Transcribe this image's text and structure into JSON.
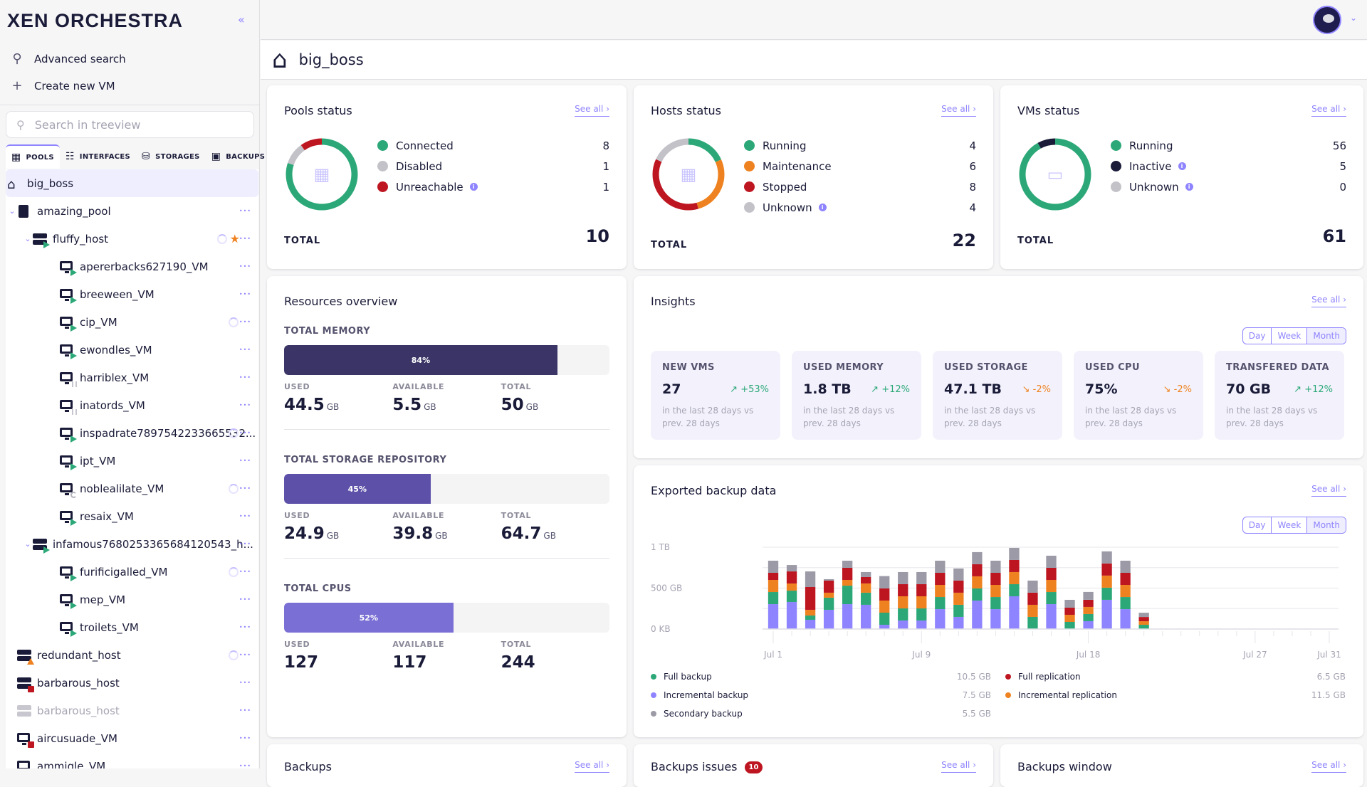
{
  "app": {
    "logo": "XEN ORCHESTRA",
    "collapse_icon": "«"
  },
  "sidebar": {
    "quick_actions": [
      {
        "label": "Advanced search",
        "icon": "search-icon"
      },
      {
        "label": "Create new VM",
        "icon": "plus-icon"
      }
    ],
    "search_placeholder": "Search in treeview",
    "tabs": [
      {
        "label": "POOLS",
        "icon": "building-icon",
        "active": true
      },
      {
        "label": "INTERFACES",
        "icon": "network-icon"
      },
      {
        "label": "STORAGES",
        "icon": "database-icon"
      },
      {
        "label": "BACKUPS",
        "icon": "save-icon"
      }
    ],
    "tree": [
      {
        "label": "big_boss",
        "type": "site",
        "depth": 0,
        "selected": true
      },
      {
        "label": "amazing_pool",
        "type": "pool",
        "depth": 0,
        "expanded": true
      },
      {
        "label": "fluffy_host",
        "type": "host",
        "depth": 1,
        "expanded": true,
        "status": "running",
        "loading": true,
        "master": true
      },
      {
        "label": "apererbacks627190_VM",
        "type": "vm",
        "depth": 2,
        "status": "running"
      },
      {
        "label": "breeween_VM",
        "type": "vm",
        "depth": 2,
        "status": "running"
      },
      {
        "label": "cip_VM",
        "type": "vm",
        "depth": 2,
        "status": "running",
        "loading": true
      },
      {
        "label": "ewondles_VM",
        "type": "vm",
        "depth": 2,
        "status": "running"
      },
      {
        "label": "harriblex_VM",
        "type": "vm",
        "depth": 2,
        "status": "paused"
      },
      {
        "label": "inatords_VM",
        "type": "vm",
        "depth": 2,
        "status": "paused"
      },
      {
        "label": "inspadrate7897542233665532...",
        "type": "vm",
        "depth": 2,
        "status": "running",
        "loading": true
      },
      {
        "label": "ipt_VM",
        "type": "vm",
        "depth": 2,
        "status": "running"
      },
      {
        "label": "noblealilate_VM",
        "type": "vm",
        "depth": 2,
        "status": "suspended",
        "loading": true
      },
      {
        "label": "resaix_VM",
        "type": "vm",
        "depth": 2,
        "status": "running"
      },
      {
        "label": "infamous7680253365684120543_h...",
        "type": "host",
        "depth": 1,
        "expanded": true,
        "status": "running"
      },
      {
        "label": "furificigalled_VM",
        "type": "vm",
        "depth": 2,
        "status": "running",
        "loading": true
      },
      {
        "label": "mep_VM",
        "type": "vm",
        "depth": 2,
        "status": "running"
      },
      {
        "label": "troilets_VM",
        "type": "vm",
        "depth": 2,
        "status": "running"
      },
      {
        "label": "redundant_host",
        "type": "host",
        "depth": 0,
        "status": "warning",
        "loading": true
      },
      {
        "label": "barbarous_host",
        "type": "host",
        "depth": 0,
        "status": "stopped"
      },
      {
        "label": "barbarous_host",
        "type": "host",
        "depth": 0,
        "status": "disabled"
      },
      {
        "label": "aircusuade_VM",
        "type": "vm",
        "depth": 0,
        "status": "stopped"
      },
      {
        "label": "ammiqle_VM",
        "type": "vm",
        "depth": 0,
        "status": "stopped"
      }
    ]
  },
  "header": {
    "avatar": "user-avatar",
    "page_title": "big_boss",
    "page_icon": "home-icon"
  },
  "see_all": "See all",
  "colors": {
    "green": "#2ca878",
    "orange": "#ef8220",
    "red": "#be1621",
    "gray": "#c3c2c8",
    "dark": "#1a1b38",
    "purple": "#8f84ff",
    "accent": "#8f84ff"
  },
  "pools_status": {
    "title": "Pools status",
    "items": [
      {
        "label": "Connected",
        "value": 8,
        "color": "#2ca878"
      },
      {
        "label": "Disabled",
        "value": 1,
        "color": "#c3c2c8"
      },
      {
        "label": "Unreachable",
        "value": 1,
        "color": "#be1621",
        "info": true
      }
    ],
    "total_label": "TOTAL",
    "total": 10
  },
  "hosts_status": {
    "title": "Hosts status",
    "items": [
      {
        "label": "Running",
        "value": 4,
        "color": "#2ca878"
      },
      {
        "label": "Maintenance",
        "value": 6,
        "color": "#ef8220"
      },
      {
        "label": "Stopped",
        "value": 8,
        "color": "#be1621"
      },
      {
        "label": "Unknown",
        "value": 4,
        "color": "#c3c2c8",
        "info": true
      }
    ],
    "total_label": "TOTAL",
    "total": 22
  },
  "vms_status": {
    "title": "VMs status",
    "items": [
      {
        "label": "Running",
        "value": 56,
        "color": "#2ca878"
      },
      {
        "label": "Inactive",
        "value": 5,
        "color": "#1a1b38",
        "info": true
      },
      {
        "label": "Unknown",
        "value": 0,
        "color": "#c3c2c8",
        "info": true
      }
    ],
    "total_label": "TOTAL",
    "total": 61
  },
  "resources": {
    "title": "Resources overview",
    "labels": {
      "used": "USED",
      "available": "AVAILABLE",
      "total": "TOTAL"
    },
    "sections": [
      {
        "caption": "TOTAL MEMORY",
        "percent": 84,
        "percent_label": "84%",
        "used": "44.5",
        "available": "5.5",
        "total": "50",
        "unit": "GB",
        "color": "#3a3566"
      },
      {
        "caption": "TOTAL STORAGE REPOSITORY",
        "percent": 45,
        "percent_label": "45%",
        "used": "24.9",
        "available": "39.8",
        "total": "64.7",
        "unit": "GB",
        "color": "#5c50a8"
      },
      {
        "caption": "TOTAL CPUS",
        "percent": 52,
        "percent_label": "52%",
        "used": "127",
        "available": "117",
        "total": "244",
        "unit": "",
        "color": "#7a6fd4"
      }
    ]
  },
  "insights": {
    "title": "Insights",
    "periods": [
      "Day",
      "Week",
      "Month"
    ],
    "active_period": "Month",
    "cards": [
      {
        "label": "NEW VMS",
        "value": "27",
        "delta": "+53%",
        "trend": "up",
        "sub": "in the last 28 days vs prev. 28 days"
      },
      {
        "label": "USED MEMORY",
        "value": "1.8 TB",
        "delta": "+12%",
        "trend": "up",
        "sub": "in the last 28 days vs prev. 28 days"
      },
      {
        "label": "USED STORAGE",
        "value": "47.1 TB",
        "delta": "-2%",
        "trend": "down",
        "sub": "in the last 28 days vs prev. 28 days"
      },
      {
        "label": "USED CPU",
        "value": "75%",
        "delta": "-2%",
        "trend": "down",
        "sub": "in the last 28 days vs prev. 28 days"
      },
      {
        "label": "TRANSFERED DATA",
        "value": "70 GB",
        "delta": "+12%",
        "trend": "up",
        "sub": "in the last 28 days vs prev. 28 days"
      }
    ]
  },
  "backup_card": {
    "title": "Exported backup data",
    "periods": [
      "Day",
      "Week",
      "Month"
    ],
    "active_period": "Month"
  },
  "chart_data": {
    "type": "bar",
    "stacked": true,
    "title": "Exported backup data",
    "xlabel": "",
    "ylabel": "",
    "ylim": [
      0,
      1000
    ],
    "y_unit": "GB",
    "y_ticks": [
      {
        "value": 0,
        "label": "0 KB"
      },
      {
        "value": 500,
        "label": "500 GB"
      },
      {
        "value": 1000,
        "label": "1 TB"
      }
    ],
    "x_ticks": [
      {
        "day": 1,
        "label": "Jul 1"
      },
      {
        "day": 9,
        "label": "Jul 9"
      },
      {
        "day": 18,
        "label": "Jul 18"
      },
      {
        "day": 27,
        "label": "Jul 27"
      },
      {
        "day": 31,
        "label": "Jul 31"
      }
    ],
    "days": 31,
    "grid": true,
    "legend_position": "bottom",
    "series": [
      {
        "name": "Incremental backup",
        "color": "#8f84ff",
        "total": "7.5 GB",
        "values": [
          304,
          330,
          113,
          235,
          304,
          296,
          52,
          104,
          104,
          243,
          148,
          348,
          243,
          400,
          0,
          304,
          0,
          96,
          357,
          243,
          0
        ]
      },
      {
        "name": "Full backup",
        "color": "#2ca878",
        "total": "10.5 GB",
        "values": [
          148,
          139,
          52,
          148,
          226,
          148,
          148,
          148,
          148,
          148,
          148,
          148,
          148,
          148,
          148,
          148,
          87,
          87,
          148,
          148,
          52
        ]
      },
      {
        "name": "Incremental replication",
        "color": "#ef8220",
        "total": "11.5 GB",
        "values": [
          148,
          87,
          70,
          61,
          70,
          113,
          148,
          148,
          148,
          148,
          148,
          148,
          148,
          148,
          148,
          148,
          87,
          87,
          148,
          148,
          43
        ]
      },
      {
        "name": "Full replication",
        "color": "#be1621",
        "total": "6.5 GB",
        "values": [
          87,
          148,
          278,
          148,
          148,
          78,
          148,
          148,
          148,
          148,
          148,
          148,
          148,
          148,
          148,
          148,
          87,
          87,
          148,
          148,
          52
        ]
      },
      {
        "name": "Secondary backup",
        "color": "#9b9aa6",
        "total": "5.5 GB",
        "values": [
          148,
          78,
          191,
          17,
          87,
          61,
          151,
          148,
          148,
          148,
          148,
          148,
          148,
          148,
          148,
          148,
          96,
          96,
          148,
          148,
          52
        ]
      }
    ],
    "legend_order": [
      "Full backup",
      "Full replication",
      "Incremental backup",
      "Incremental replication",
      "Secondary backup"
    ]
  },
  "bottom_cards": [
    {
      "title": "Backups",
      "see_all": "See all"
    },
    {
      "title": "Backups issues",
      "badge": "10",
      "see_all": "See all"
    },
    {
      "title": "Backups window",
      "see_all": "See all"
    }
  ]
}
